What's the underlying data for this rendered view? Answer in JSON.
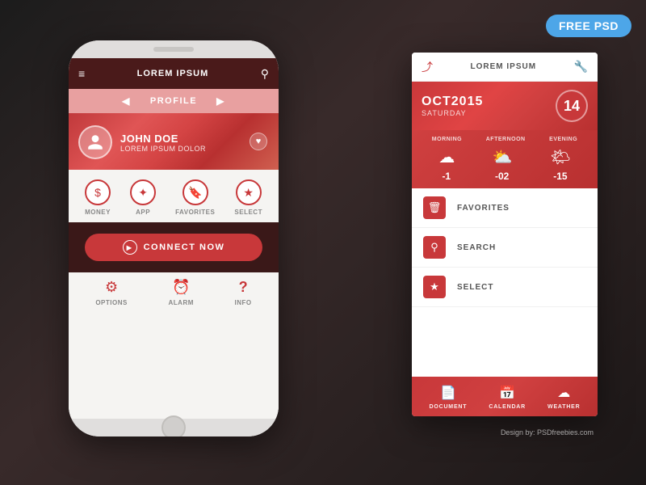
{
  "badge": {
    "label": "FREE PSD"
  },
  "phone": {
    "header": {
      "title": "LOREM IPSUM",
      "hamburger": "≡",
      "search": "🔍"
    },
    "profile_nav": {
      "label": "PROFILE",
      "arrow_left": "◀",
      "arrow_right": "▶"
    },
    "profile": {
      "name": "JOHN DOE",
      "subtitle": "LOREM IPSUM DOLOR",
      "heart": "♥"
    },
    "menu_items": [
      {
        "label": "MONEY",
        "icon": "$"
      },
      {
        "label": "APP",
        "icon": "✦"
      },
      {
        "label": "FAVORITES",
        "icon": "🔖"
      },
      {
        "label": "SELECT",
        "icon": "★"
      }
    ],
    "connect_btn": "CONNECT NOW",
    "bottom_nav": [
      {
        "label": "OPTIONS",
        "icon": "⚙"
      },
      {
        "label": "ALARM",
        "icon": "⏰"
      },
      {
        "label": "INFO",
        "icon": "?"
      }
    ]
  },
  "panel": {
    "header": {
      "title": "LOREM IPSUM",
      "share_icon": "share",
      "wrench_icon": "wrench"
    },
    "date": {
      "month_year": "OCT2015",
      "day": "SATURDAY",
      "num": "14"
    },
    "weather": {
      "periods": [
        "MORNING",
        "AFTERNOON",
        "EVENING"
      ],
      "icons": [
        "☁",
        "⛅",
        "🌤"
      ],
      "temps": [
        "-1",
        "-02",
        "-15"
      ]
    },
    "list_items": [
      {
        "label": "FAVORITES",
        "icon": "🗑"
      },
      {
        "label": "SEARCH",
        "icon": "🔍"
      },
      {
        "label": "SELECT",
        "icon": "★"
      }
    ],
    "bottom_nav": [
      {
        "label": "DOCUMENT",
        "icon": "📄"
      },
      {
        "label": "CALENDAR",
        "icon": "📅"
      },
      {
        "label": "WEATHER",
        "icon": "☁"
      }
    ]
  },
  "design_by": "Design by: PSDfreebies.com"
}
